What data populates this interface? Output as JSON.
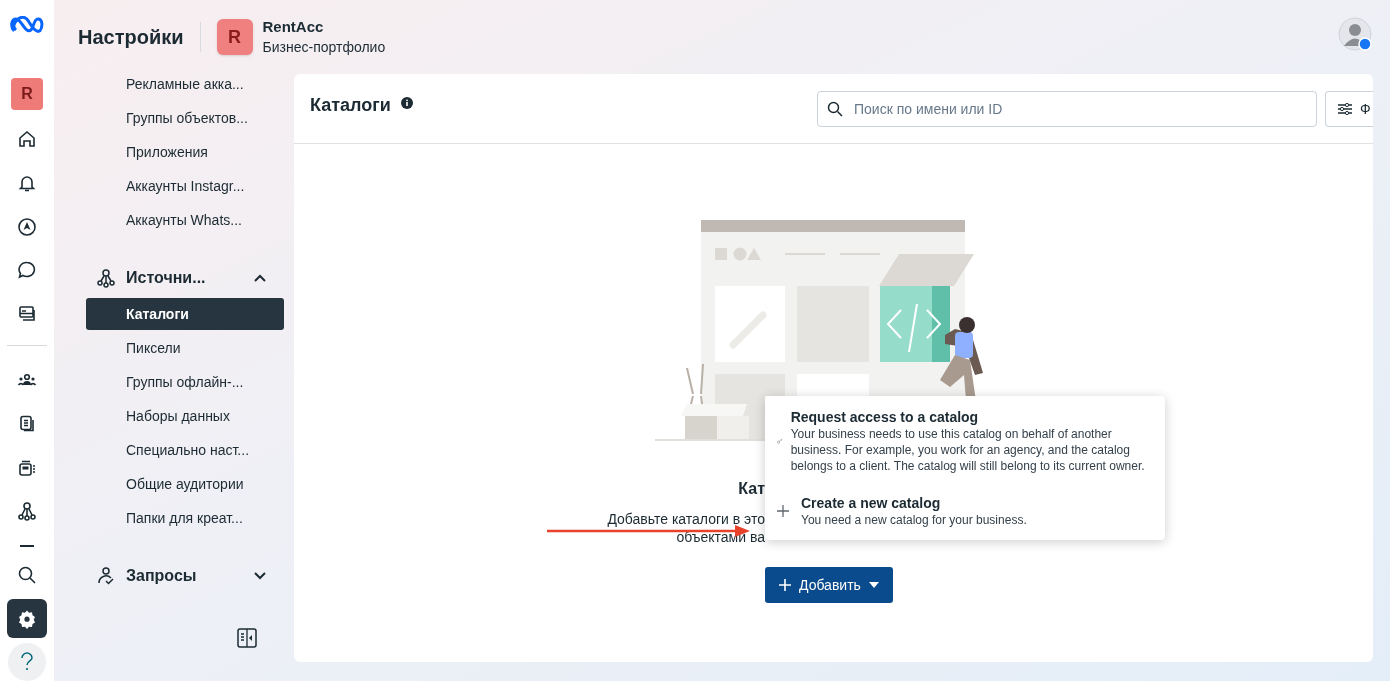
{
  "rail": {
    "avatar": "R",
    "items": [
      {
        "kind": "home",
        "selected": false
      },
      {
        "kind": "bell",
        "selected": false
      },
      {
        "kind": "compass",
        "selected": false
      },
      {
        "kind": "chat",
        "selected": false
      },
      {
        "kind": "cards",
        "selected": false
      },
      {
        "kind": "divider"
      },
      {
        "kind": "people",
        "selected": false
      },
      {
        "kind": "document",
        "selected": false
      },
      {
        "kind": "calculator",
        "selected": false
      },
      {
        "kind": "network",
        "selected": false
      },
      {
        "kind": "dash"
      },
      {
        "kind": "search",
        "selected": false
      },
      {
        "kind": "settings",
        "selected": true
      },
      {
        "kind": "help"
      }
    ]
  },
  "header": {
    "title": "Настройки",
    "business": {
      "avatar": "R",
      "name": "RentAcc",
      "subtitle": "Бизнес-портфолио"
    }
  },
  "sidebar": {
    "items": [
      {
        "label": "Рекламные акка...",
        "selected": false
      },
      {
        "label": "Группы объектов...",
        "selected": false
      },
      {
        "label": "Приложения",
        "selected": false
      },
      {
        "label": "Аккаунты Instagr...",
        "selected": false
      },
      {
        "label": "Аккаунты Whats...",
        "selected": false
      }
    ],
    "sections": [
      {
        "kind": "sources",
        "label": "Источни...",
        "expanded": true,
        "children": [
          {
            "label": "Каталоги",
            "selected": true
          },
          {
            "label": "Пиксели",
            "selected": false
          },
          {
            "label": "Группы офлайн-...",
            "selected": false
          },
          {
            "label": "Наборы данных",
            "selected": false
          },
          {
            "label": "Специально наст...",
            "selected": false
          },
          {
            "label": "Общие аудитории",
            "selected": false
          },
          {
            "label": "Папки для креат...",
            "selected": false
          }
        ]
      },
      {
        "kind": "requests",
        "label": "Запросы",
        "expanded": false
      }
    ]
  },
  "page": {
    "title": "Каталоги",
    "search": {
      "placeholder": "Поиск по имени или ID"
    },
    "filter_button": "Ф",
    "empty": {
      "title": "Кат",
      "lines": [
        "Добавьте каталоги в это",
        "объектами ва"
      ]
    },
    "add_button": "Добавить",
    "menu": [
      {
        "kind": "key",
        "title": "Request access to a catalog",
        "description": "Your business needs to use this catalog on behalf of another business. For example, you work for an agency, and the catalog belongs to a client. The catalog will still belong to its current owner."
      },
      {
        "kind": "plus",
        "title": "Create a new catalog",
        "description": "You need a new catalog for your business."
      }
    ]
  }
}
